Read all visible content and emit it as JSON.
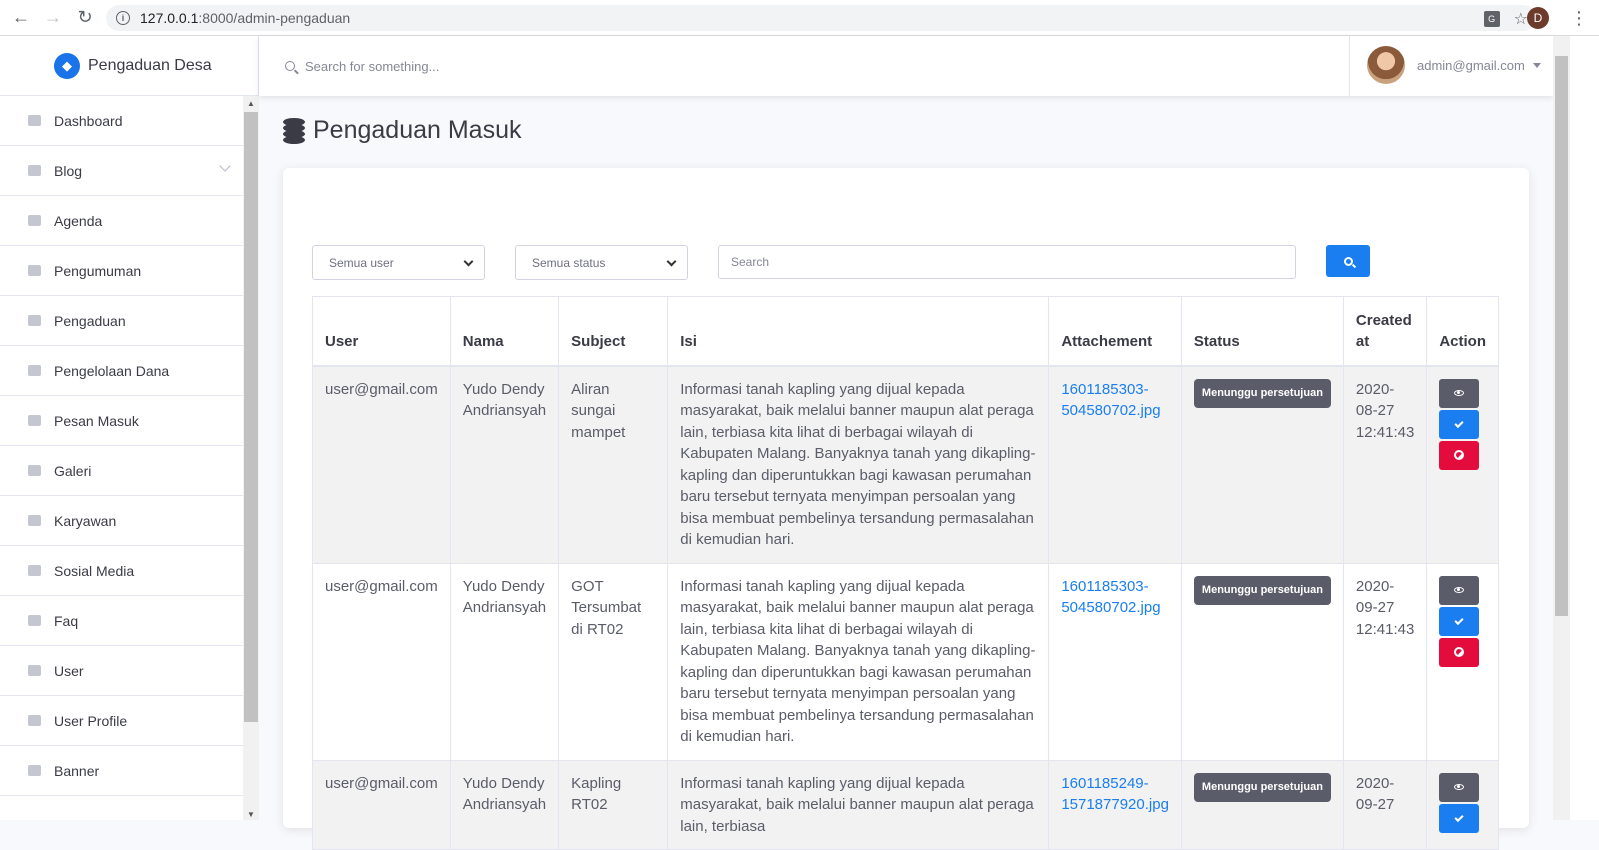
{
  "browser": {
    "url_host": "127.0.0.1",
    "url_path": ":8000/admin-pengaduan",
    "profile_initial": "D"
  },
  "brand": {
    "name": "Pengaduan Desa"
  },
  "sidebar": {
    "items": [
      {
        "label": "Dashboard"
      },
      {
        "label": "Blog"
      },
      {
        "label": "Agenda"
      },
      {
        "label": "Pengumuman"
      },
      {
        "label": "Pengaduan"
      },
      {
        "label": "Pengelolaan Dana"
      },
      {
        "label": "Pesan Masuk"
      },
      {
        "label": "Galeri"
      },
      {
        "label": "Karyawan"
      },
      {
        "label": "Sosial Media"
      },
      {
        "label": "Faq"
      },
      {
        "label": "User"
      },
      {
        "label": "User Profile"
      },
      {
        "label": "Banner"
      }
    ]
  },
  "topbar": {
    "search_placeholder": "Search for something...",
    "user_email": "admin@gmail.com"
  },
  "page": {
    "title": "Pengaduan Masuk"
  },
  "filters": {
    "user_select": "Semua user",
    "status_select": "Semua status",
    "search_placeholder": "Search"
  },
  "table": {
    "headers": [
      "User",
      "Nama",
      "Subject",
      "Isi",
      "Attachement",
      "Status",
      "Created at",
      "Action"
    ],
    "rows": [
      {
        "user": "user@gmail.com",
        "nama": "Yudo Dendy Andriansyah",
        "subject": "Aliran sungai mampet",
        "isi": "Informasi tanah kapling yang dijual kepada masyarakat, baik melalui banner maupun alat peraga lain, terbiasa kita lihat di berbagai wilayah di Kabupaten Malang. Banyaknya tanah yang dikapling-kapling dan diperuntukkan bagi kawasan perumahan baru tersebut ternyata menyimpan persoalan yang bisa membuat pembelinya tersandung permasalahan di kemudian hari.",
        "attachment": "1601185303-504580702.jpg",
        "status": "Menunggu persetujuan",
        "created": "2020-08-27 12:41:43"
      },
      {
        "user": "user@gmail.com",
        "nama": "Yudo Dendy Andriansyah",
        "subject": "GOT Tersumbat di RT02",
        "isi": "Informasi tanah kapling yang dijual kepada masyarakat, baik melalui banner maupun alat peraga lain, terbiasa kita lihat di berbagai wilayah di Kabupaten Malang. Banyaknya tanah yang dikapling-kapling dan diperuntukkan bagi kawasan perumahan baru tersebut ternyata menyimpan persoalan yang bisa membuat pembelinya tersandung permasalahan di kemudian hari.",
        "attachment": "1601185303-504580702.jpg",
        "status": "Menunggu persetujuan",
        "created": "2020-09-27 12:41:43"
      },
      {
        "user": "user@gmail.com",
        "nama": "Yudo Dendy Andriansyah",
        "subject": "Kapling RT02",
        "isi": "Informasi tanah kapling yang dijual kepada masyarakat, baik melalui banner maupun alat peraga lain, terbiasa",
        "attachment": "1601185249-1571877920.jpg",
        "status": "Menunggu persetujuan",
        "created": "2020-09-27"
      }
    ]
  }
}
